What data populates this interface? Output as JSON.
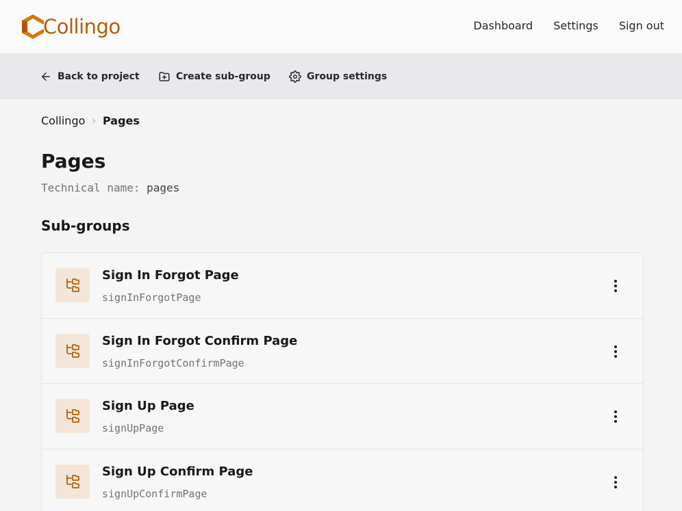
{
  "brand": {
    "name": "Collingo",
    "color": "#b45f06"
  },
  "nav": {
    "dashboard": "Dashboard",
    "settings": "Settings",
    "signout": "Sign out"
  },
  "actions": {
    "back": "Back to project",
    "create": "Create sub-group",
    "group_settings": "Group settings"
  },
  "breadcrumb": {
    "root": "Collingo",
    "current": "Pages"
  },
  "page": {
    "title": "Pages",
    "tech_label": "Technical name:",
    "tech_value": "pages",
    "subgroups_heading": "Sub-groups"
  },
  "subgroups": [
    {
      "name": "Sign In Forgot Page",
      "tech": "signInForgotPage"
    },
    {
      "name": "Sign In Forgot Confirm Page",
      "tech": "signInForgotConfirmPage"
    },
    {
      "name": "Sign Up Page",
      "tech": "signUpPage"
    },
    {
      "name": "Sign Up Confirm Page",
      "tech": "signUpConfirmPage"
    }
  ],
  "icons": {
    "back": "arrow-left-icon",
    "create": "folder-plus-icon",
    "settings": "gear-icon",
    "subgroup": "folder-tree-icon",
    "menu": "more-vertical-icon",
    "breadcrumb_sep": "chevron-right-icon"
  }
}
